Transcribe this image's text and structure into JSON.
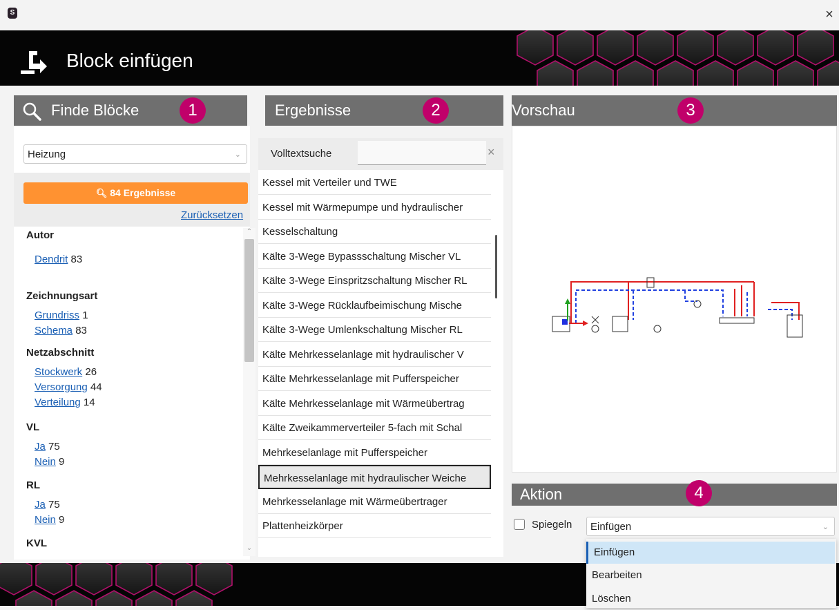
{
  "window": {
    "app_icon": "S",
    "close_glyph": "×"
  },
  "header": {
    "title": "Block einfügen"
  },
  "search_panel": {
    "title": "Finde Blöcke",
    "badge": "1",
    "category": "Heizung",
    "search_button": "84 Ergebnisse",
    "reset_link": "Zurücksetzen",
    "facets": [
      {
        "title": "Autor",
        "items": [
          {
            "label": "Dendrit",
            "count": "83"
          }
        ]
      },
      {
        "title": "Zeichnungsart",
        "items": [
          {
            "label": "Grundriss",
            "count": "1"
          },
          {
            "label": "Schema",
            "count": "83"
          }
        ]
      },
      {
        "title": "Netzabschnitt",
        "items": [
          {
            "label": "Stockwerk",
            "count": "26"
          },
          {
            "label": "Versorgung",
            "count": "44"
          },
          {
            "label": "Verteilung",
            "count": "14"
          }
        ]
      },
      {
        "title": "VL",
        "items": [
          {
            "label": "Ja",
            "count": "75"
          },
          {
            "label": "Nein",
            "count": "9"
          }
        ]
      },
      {
        "title": "RL",
        "items": [
          {
            "label": "Ja",
            "count": "75"
          },
          {
            "label": "Nein",
            "count": "9"
          }
        ]
      },
      {
        "title": "KVL",
        "items": []
      }
    ]
  },
  "results_panel": {
    "title": "Ergebnisse",
    "badge": "2",
    "fulltext_label": "Volltextsuche",
    "fulltext_value": "",
    "clear_glyph": "×",
    "items": [
      "Kessel mit Verteiler und TWE",
      "Kessel mit Wärmepumpe und hydraulischer",
      "Kesselschaltung",
      "Kälte 3-Wege Bypassschaltung Mischer VL",
      "Kälte 3-Wege Einspritzschaltung Mischer RL",
      "Kälte 3-Wege Rücklaufbeimischung Mische",
      "Kälte 3-Wege Umlenkschaltung Mischer RL",
      "Kälte Mehrkesselanlage mit hydraulischer V",
      "Kälte Mehrkesselanlage mit Pufferspeicher",
      "Kälte Mehrkesselanlage mit Wärmeübertrag",
      "Kälte Zweikammerverteiler 5-fach mit Schal",
      "Mehrkeselanlage mit Pufferspeicher",
      "Mehrkesselanlage mit hydraulischer Weiche",
      "Mehrkesselanlage mit Wärmeübertrager",
      "Plattenheizkörper"
    ],
    "selected_index": 12
  },
  "preview_panel": {
    "title": "Vorschau",
    "badge": "3"
  },
  "action_panel": {
    "title": "Aktion",
    "badge": "4",
    "mirror_label": "Spiegeln",
    "mirror_checked": false,
    "action_value": "Einfügen",
    "options": [
      "Einfügen",
      "Bearbeiten",
      "Löschen"
    ]
  },
  "colors": {
    "accent_orange": "#ff9231",
    "badge_magenta": "#c0006a",
    "panel_header": "#6f6f6f",
    "link": "#1a5fb4"
  },
  "icons": [
    "app-logo-icon",
    "close-icon",
    "insert-block-icon",
    "search-icon",
    "chevron-down-icon",
    "scroll-up-icon",
    "scroll-down-icon",
    "clear-icon",
    "checkbox-icon"
  ]
}
